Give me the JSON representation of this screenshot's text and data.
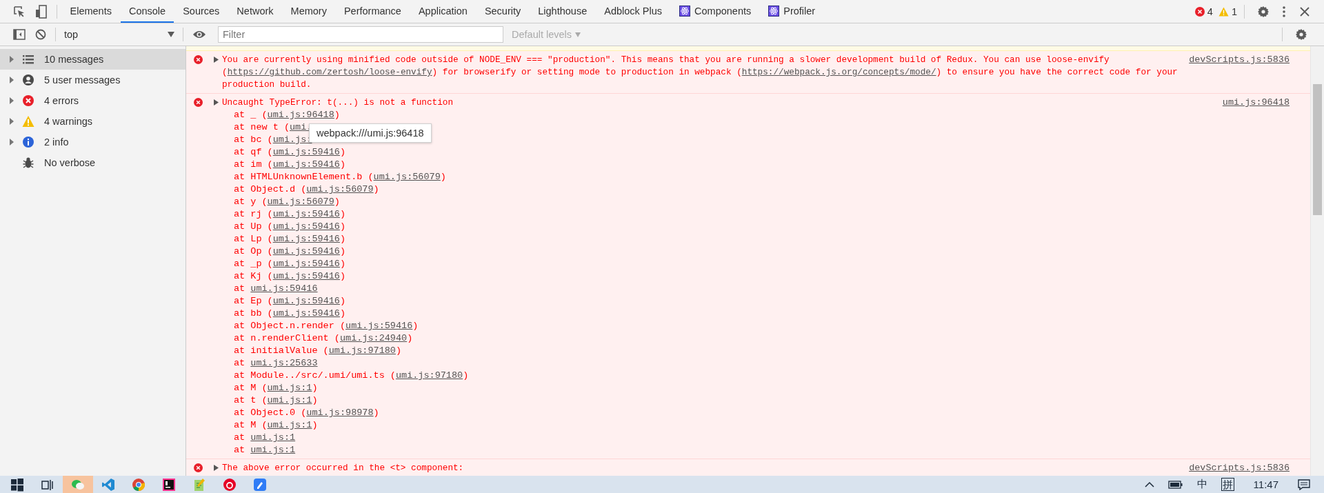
{
  "tabs": [
    {
      "label": "Elements",
      "kind": "plain",
      "selected": false
    },
    {
      "label": "Console",
      "kind": "plain",
      "selected": true
    },
    {
      "label": "Sources",
      "kind": "plain",
      "selected": false
    },
    {
      "label": "Network",
      "kind": "plain",
      "selected": false
    },
    {
      "label": "Memory",
      "kind": "plain",
      "selected": false
    },
    {
      "label": "Performance",
      "kind": "plain",
      "selected": false
    },
    {
      "label": "Application",
      "kind": "plain",
      "selected": false
    },
    {
      "label": "Security",
      "kind": "plain",
      "selected": false
    },
    {
      "label": "Lighthouse",
      "kind": "plain",
      "selected": false
    },
    {
      "label": "Adblock Plus",
      "kind": "plain",
      "selected": false
    },
    {
      "label": "Components",
      "kind": "react",
      "selected": false
    },
    {
      "label": "Profiler",
      "kind": "react",
      "selected": false
    }
  ],
  "issue_counts": {
    "errors": "4",
    "warnings": "1"
  },
  "toolbar": {
    "context": "top",
    "filter": {
      "placeholder": "Filter"
    },
    "levels": "Default levels"
  },
  "sidebar": {
    "items": [
      {
        "label": "10 messages",
        "kind": "list",
        "selected": true,
        "expandable": true
      },
      {
        "label": "5 user messages",
        "kind": "user",
        "selected": false,
        "expandable": true
      },
      {
        "label": "4 errors",
        "kind": "error",
        "selected": false,
        "expandable": true
      },
      {
        "label": "4 warnings",
        "kind": "warning",
        "selected": false,
        "expandable": true
      },
      {
        "label": "2 info",
        "kind": "info",
        "selected": false,
        "expandable": true
      },
      {
        "label": "No verbose",
        "kind": "verbose",
        "selected": false,
        "expandable": false
      }
    ]
  },
  "messages": [
    {
      "kind": "error",
      "source": "devScripts.js:5836",
      "text": [
        {
          "text": "You are currently using minified code outside of NODE_ENV === \"production\". This means that you are running a slower development build of Redux. You can use loose-envify ("
        },
        {
          "link": "https://github.com/zertosh/loose-envify"
        },
        {
          "text": ") for browserify or setting mode to production in webpack ("
        },
        {
          "link": "https://webpack.js.org/concepts/mode/"
        },
        {
          "text": ") to ensure you have the correct code for your production build."
        }
      ]
    },
    {
      "kind": "error",
      "source": "umi.js:96418",
      "text": [
        {
          "text": "Uncaught TypeError: t(...) is not a function"
        }
      ],
      "stack": [
        {
          "prefix": "at _ (",
          "link": "umi.js:96418",
          "suffix": ")"
        },
        {
          "prefix": "at new t (",
          "link": "umi."
        },
        {
          "prefix": "at bc (",
          "link": "umi.js:"
        },
        {
          "prefix": "at qf (",
          "link": "umi.js:59416",
          "suffix": ")"
        },
        {
          "prefix": "at im (",
          "link": "umi.js:59416",
          "suffix": ")"
        },
        {
          "prefix": "at HTMLUnknownElement.b (",
          "link": "umi.js:56079",
          "suffix": ")"
        },
        {
          "prefix": "at Object.d (",
          "link": "umi.js:56079",
          "suffix": ")"
        },
        {
          "prefix": "at y (",
          "link": "umi.js:56079",
          "suffix": ")"
        },
        {
          "prefix": "at rj (",
          "link": "umi.js:59416",
          "suffix": ")"
        },
        {
          "prefix": "at Up (",
          "link": "umi.js:59416",
          "suffix": ")"
        },
        {
          "prefix": "at Lp (",
          "link": "umi.js:59416",
          "suffix": ")"
        },
        {
          "prefix": "at Op (",
          "link": "umi.js:59416",
          "suffix": ")"
        },
        {
          "prefix": "at _p (",
          "link": "umi.js:59416",
          "suffix": ")"
        },
        {
          "prefix": "at Kj (",
          "link": "umi.js:59416",
          "suffix": ")"
        },
        {
          "prefix": "at ",
          "link": "umi.js:59416"
        },
        {
          "prefix": "at Ep (",
          "link": "umi.js:59416",
          "suffix": ")"
        },
        {
          "prefix": "at bb (",
          "link": "umi.js:59416",
          "suffix": ")"
        },
        {
          "prefix": "at Object.n.render (",
          "link": "umi.js:59416",
          "suffix": ")"
        },
        {
          "prefix": "at n.renderClient (",
          "link": "umi.js:24940",
          "suffix": ")"
        },
        {
          "prefix": "at initialValue (",
          "link": "umi.js:97180",
          "suffix": ")"
        },
        {
          "prefix": "at ",
          "link": "umi.js:25633"
        },
        {
          "prefix": "at Module../src/.umi/umi.ts (",
          "link": "umi.js:97180",
          "suffix": ")"
        },
        {
          "prefix": "at M (",
          "link": "umi.js:1",
          "suffix": ")"
        },
        {
          "prefix": "at t (",
          "link": "umi.js:1",
          "suffix": ")"
        },
        {
          "prefix": "at Object.0 (",
          "link": "umi.js:98978",
          "suffix": ")"
        },
        {
          "prefix": "at M (",
          "link": "umi.js:1",
          "suffix": ")"
        },
        {
          "prefix": "at ",
          "link": "umi.js:1"
        },
        {
          "prefix": "at ",
          "link": "umi.js:1"
        }
      ]
    },
    {
      "kind": "error",
      "source": "devScripts.js:5836",
      "text": [
        {
          "text": "The above error occurred in the <t> component:"
        }
      ]
    }
  ],
  "tooltip": "webpack:///umi.js:96418",
  "taskbar": {
    "apps": [
      {
        "kind": "start",
        "active": false
      },
      {
        "kind": "taskview",
        "active": false
      },
      {
        "kind": "wechat",
        "active": true
      },
      {
        "kind": "vscode",
        "active": false
      },
      {
        "kind": "chrome",
        "active": false
      },
      {
        "kind": "jetbrains",
        "active": false
      },
      {
        "kind": "notepad",
        "active": false
      },
      {
        "kind": "netease",
        "active": false
      },
      {
        "kind": "blueapp",
        "active": false
      }
    ],
    "ime": "中",
    "ime_mode": "拼",
    "time": "11:47"
  }
}
